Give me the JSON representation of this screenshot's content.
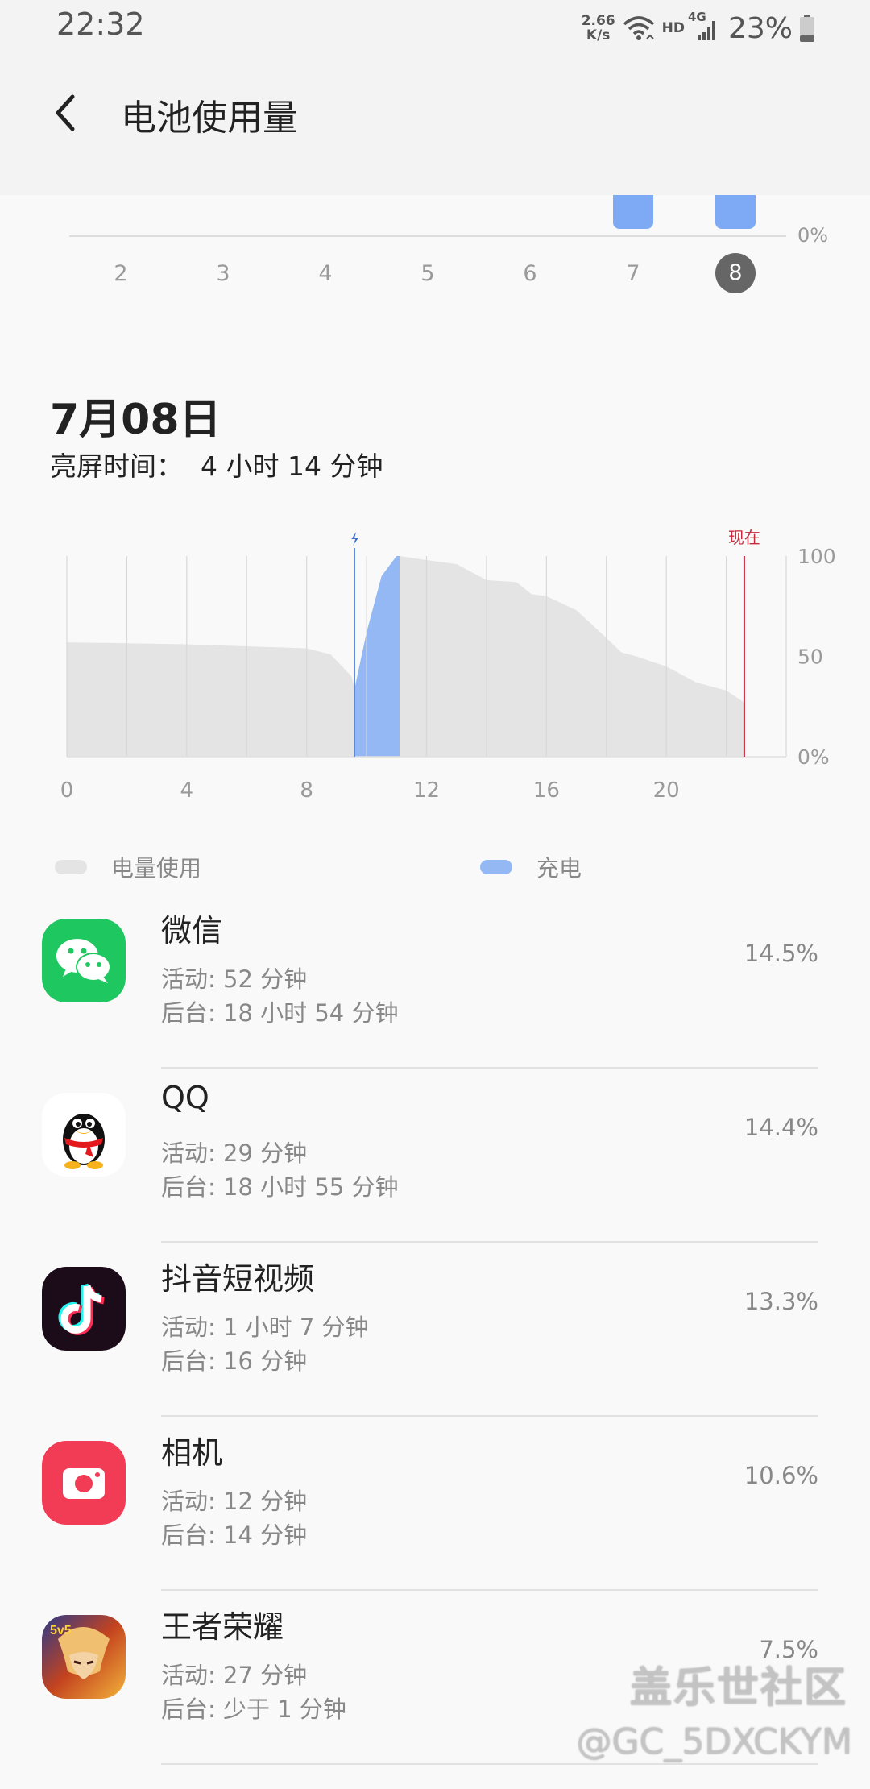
{
  "status_bar": {
    "time": "22:32",
    "speed_value": "2.66",
    "speed_unit": "K/s",
    "hd": "HD",
    "network": "4G",
    "battery": "23%"
  },
  "header": {
    "title": "电池使用量"
  },
  "week_chart": {
    "labels": [
      "2",
      "3",
      "4",
      "5",
      "6",
      "7",
      "8"
    ],
    "selected": "8",
    "zero_label": "0%"
  },
  "day": {
    "date": "7月08日",
    "screen_time_label": "亮屏时间：",
    "screen_time_value": "4 小时 14 分钟"
  },
  "chart_data": {
    "type": "area",
    "x_ticks": [
      "0",
      "4",
      "8",
      "12",
      "16",
      "20"
    ],
    "y_ticks": [
      "100",
      "50",
      "0%"
    ],
    "now_label": "现在",
    "xlim": [
      0,
      24
    ],
    "ylim": [
      0,
      100
    ],
    "series": [
      {
        "name": "电量使用",
        "color": "#e4e4e4",
        "points": [
          [
            0,
            57
          ],
          [
            4,
            56
          ],
          [
            8,
            54
          ],
          [
            8.8,
            51
          ],
          [
            9.5,
            40
          ],
          [
            9.6,
            34
          ],
          [
            9.8,
            0
          ]
        ]
      },
      {
        "name": "充电",
        "color": "#93b8f3",
        "points": [
          [
            9.6,
            34
          ],
          [
            10,
            62
          ],
          [
            10.5,
            90
          ],
          [
            11,
            100
          ],
          [
            11.1,
            100
          ]
        ]
      },
      {
        "name": "电量使用",
        "color": "#e4e4e4",
        "points": [
          [
            11.1,
            100
          ],
          [
            12,
            98
          ],
          [
            13,
            96
          ],
          [
            14,
            88
          ],
          [
            15,
            87
          ],
          [
            15.5,
            81
          ],
          [
            16,
            80
          ],
          [
            17,
            73
          ],
          [
            17.8,
            62
          ],
          [
            18.5,
            52
          ],
          [
            19,
            50
          ],
          [
            20,
            45
          ],
          [
            21,
            37
          ],
          [
            22,
            33
          ],
          [
            22.6,
            27
          ]
        ]
      }
    ],
    "now_x": 22.6,
    "legend": [
      {
        "label": "电量使用",
        "color": "#e4e4e4"
      },
      {
        "label": "充电",
        "color": "#93b8f3"
      }
    ]
  },
  "apps": [
    {
      "name": "微信",
      "active": "活动: 52 分钟",
      "background": "后台: 18 小时 54 分钟",
      "percent": "14.5%",
      "icon": "wechat-icon"
    },
    {
      "name": "QQ",
      "active": "活动: 29 分钟",
      "background": "后台: 18 小时 55 分钟",
      "percent": "14.4%",
      "icon": "qq-icon"
    },
    {
      "name": "抖音短视频",
      "active": "活动: 1 小时 7 分钟",
      "background": "后台: 16 分钟",
      "percent": "13.3%",
      "icon": "douyin-icon"
    },
    {
      "name": "相机",
      "active": "活动: 12 分钟",
      "background": "后台: 14 分钟",
      "percent": "10.6%",
      "icon": "camera-icon"
    },
    {
      "name": "王者荣耀",
      "active": "活动: 27 分钟",
      "background": "后台: 少于 1 分钟",
      "percent": "7.5%",
      "icon": "honor-of-kings-icon"
    }
  ],
  "watermark": {
    "line1": "盖乐世社区",
    "line2": "@GC_5DXCKYM"
  }
}
